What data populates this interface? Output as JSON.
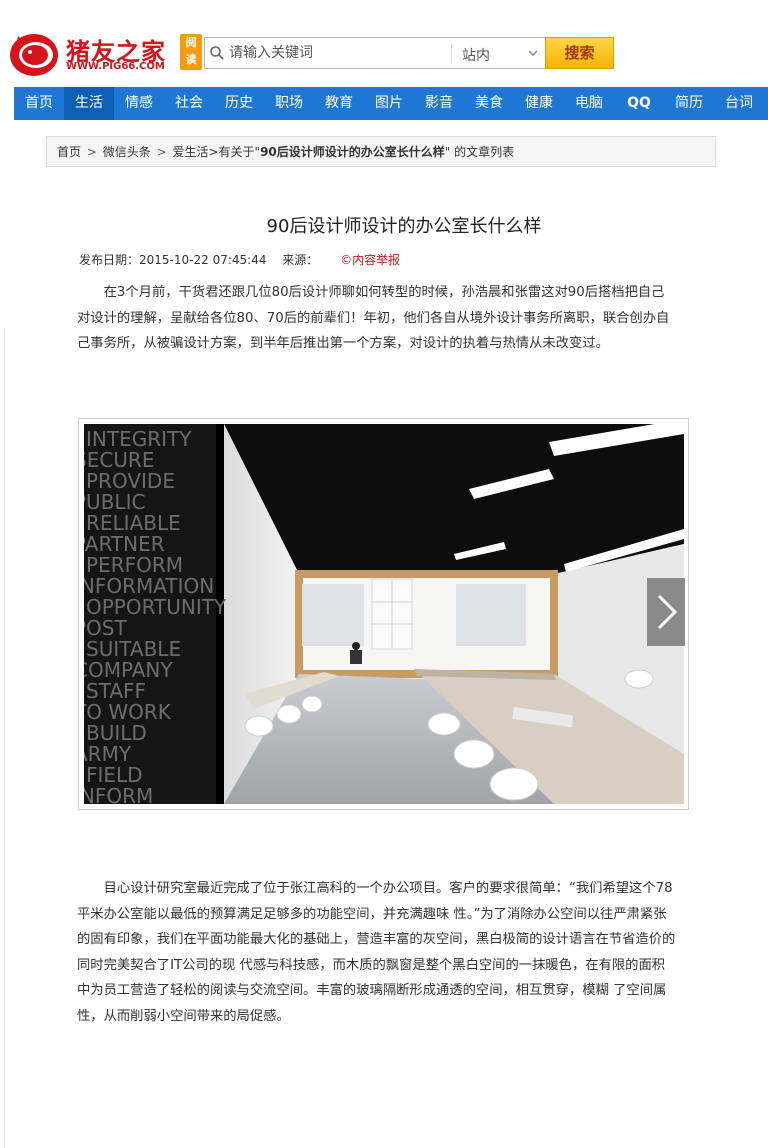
{
  "logo": {
    "title": "猪友之家",
    "url": "WWW.PIG66.COM",
    "badge_line1": "阅",
    "badge_line2": "读",
    "brand_color": "#d6121b"
  },
  "search": {
    "placeholder": "请输入关键词",
    "scope": "站内",
    "button_label": "搜索"
  },
  "nav": {
    "items": [
      "首页",
      "生活",
      "情感",
      "社会",
      "历史",
      "职场",
      "教育",
      "图片",
      "影音",
      "美食",
      "健康",
      "电脑",
      "QQ",
      "简历",
      "台词"
    ],
    "active_index": 1,
    "color": "#1e78d3"
  },
  "breadcrumb": {
    "home": "首页",
    "sep": ">",
    "level2": "微信头条",
    "level3": "爱生活",
    "prefix": ">有关于\"",
    "keyword": "90后设计师设计的办公室长什么样",
    "suffix": "\" 的文章列表"
  },
  "article": {
    "title": "90后设计师设计的办公室长什么样",
    "date_label": "发布日期：",
    "date": "2015-10-22 07:45:44",
    "source_label": "来源：",
    "report": "©内容举报",
    "para1": "在3个月前，干货君还跟几位80后设计师聊如何转型的时候，孙浩晨和张雷这对90后搭档把自己对设计的理解，呈献给各位80、70后的前辈们！年初，他们各自从境外设计事务所离职，联合创办自己事务所，从被骗设计方案，到半年后推出第一个方案，对设计的执着与热情从未改变过。",
    "para2": "目心设计研究室最近完成了位于张江高科的一个办公项目。客户的要求很简单：“我们希望这个78平米办公室能以最低的预算满足足够多的功能空间，并充满趣味 性。”为了消除办公空间以往严肃紧张的固有印象，我们在平面功能最大化的基础上，营造丰富的灰空间，黑白极简的设计语言在节省造价的同时完美契合了IT公司的现 代感与科技感，而木质的飘窗是整个黑白空间的一抹暖色，在有限的面积中为员工营造了轻松的阅读与交流空间。丰富的玻璃隔断形成通透的空间，相互贯穿，模糊 了空间属性，从而削弱小空间带来的局促感。"
  },
  "photo": {
    "glass_words": [
      "INTEGRITY",
      "SECURE",
      "PROVIDE",
      "PUBLIC",
      "RELIABLE",
      "PARTNER",
      "PERFORM",
      "INFORMATION",
      "OPPORTUNITY",
      "POST",
      "SUITABLE",
      "COMPANY",
      "STAFF",
      "TO WORK",
      "BUILD",
      "ARMY",
      "FIELD",
      "INFORM"
    ]
  }
}
